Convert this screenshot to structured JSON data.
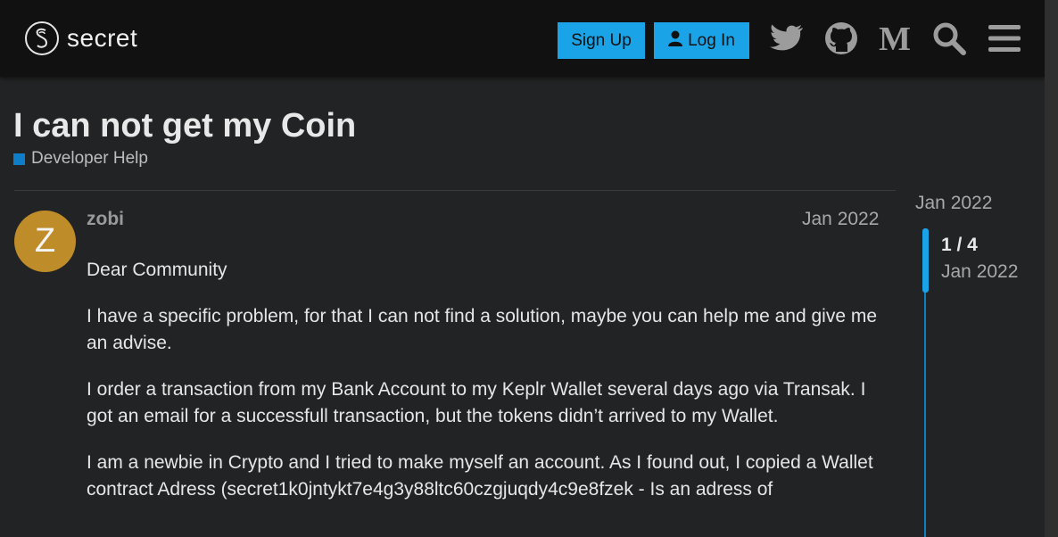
{
  "header": {
    "logo_text": "secret",
    "signup_label": "Sign Up",
    "login_label": "Log In",
    "icons": [
      "twitter-icon",
      "github-icon",
      "medium-icon",
      "search-icon",
      "hamburger-menu-icon"
    ]
  },
  "topic": {
    "title": "I can not get my Coin",
    "category": "Developer Help",
    "category_color": "#0f7ec8"
  },
  "post": {
    "avatar_letter": "Z",
    "avatar_color": "#bf8c2a",
    "username": "zobi",
    "date": "Jan 2022",
    "paragraphs": [
      "Dear Community",
      "I have a specific problem, for that I can not find a solution, maybe you can help me and give me an advise.",
      "I order a transaction from my Bank Account to my Keplr Wallet several days ago via Transak. I got an email for a successfull transaction, but the tokens didn’t arrived to my Wallet.",
      "I am a newbie in Crypto and I tried to make myself an account. As I found out, I copied a Wallet contract Adress (secret1k0jntykt7e4g3y88ltc60czgjuqdy4c9e8fzek - Is an adress of"
    ]
  },
  "timeline": {
    "start_date": "Jan 2022",
    "position": "1 / 4",
    "position_date": "Jan 2022",
    "accent": "#1aa3e6"
  }
}
